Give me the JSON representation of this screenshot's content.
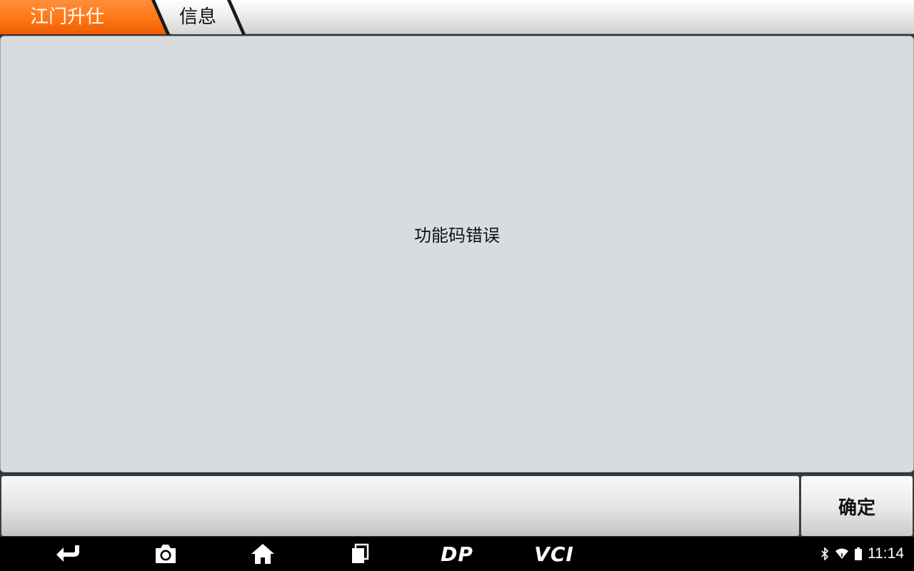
{
  "breadcrumb": {
    "home_label": "江门升仕",
    "current_label": "信息"
  },
  "message": {
    "text": "功能码错误"
  },
  "actions": {
    "confirm_label": "确定"
  },
  "navbar": {
    "back_icon": "back-arrow-icon",
    "camera_icon": "camera-icon",
    "home_icon": "home-icon",
    "recent_icon": "recent-apps-icon",
    "dp_label": "DP",
    "vci_label": "VCI"
  },
  "status": {
    "time": "11:14",
    "icons": [
      "bluetooth-icon",
      "wifi-icon",
      "battery-icon"
    ]
  },
  "colors": {
    "accent": "#ff7615",
    "panel": "#d9dcdf"
  }
}
